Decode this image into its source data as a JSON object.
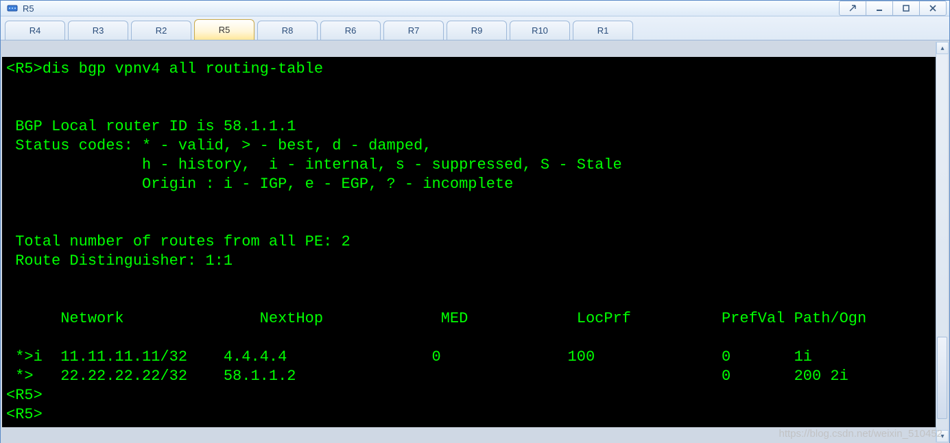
{
  "window": {
    "title": "R5"
  },
  "tabs": [
    {
      "label": "R4",
      "active": false
    },
    {
      "label": "R3",
      "active": false
    },
    {
      "label": "R2",
      "active": false
    },
    {
      "label": "R5",
      "active": true
    },
    {
      "label": "R8",
      "active": false
    },
    {
      "label": "R6",
      "active": false
    },
    {
      "label": "R7",
      "active": false
    },
    {
      "label": "R9",
      "active": false
    },
    {
      "label": "R10",
      "active": false
    },
    {
      "label": "R1",
      "active": false
    }
  ],
  "terminal": {
    "prompt": "<R5>",
    "command": "dis bgp vpnv4 all routing-table",
    "local_router_id_line": " BGP Local router ID is 58.1.1.1",
    "status_codes_lines": [
      " Status codes: * - valid, > - best, d - damped,",
      "               h - history,  i - internal, s - suppressed, S - Stale",
      "               Origin : i - IGP, e - EGP, ? - incomplete"
    ],
    "totals_line": " Total number of routes from all PE: 2",
    "rd_line": " Route Distinguisher: 1:1",
    "header": {
      "c1": "Network",
      "c2": "NextHop",
      "c3": "MED",
      "c4": "LocPrf",
      "c5": "PrefVal",
      "c6": "Path/Ogn"
    },
    "routes": [
      {
        "flags": "*>i",
        "network": "11.11.11.11/32",
        "nexthop": "4.4.4.4",
        "med": "0",
        "locprf": "100",
        "prefval": "0",
        "pathogn": "1i"
      },
      {
        "flags": "*>",
        "network": "22.22.22.22/32",
        "nexthop": "58.1.1.2",
        "med": "",
        "locprf": "",
        "prefval": "0",
        "pathogn": "200 2i"
      }
    ],
    "trailing_prompts": [
      "<R5>",
      "<R5>"
    ]
  },
  "watermark": "https://blog.csdn.net/weixin_510452"
}
